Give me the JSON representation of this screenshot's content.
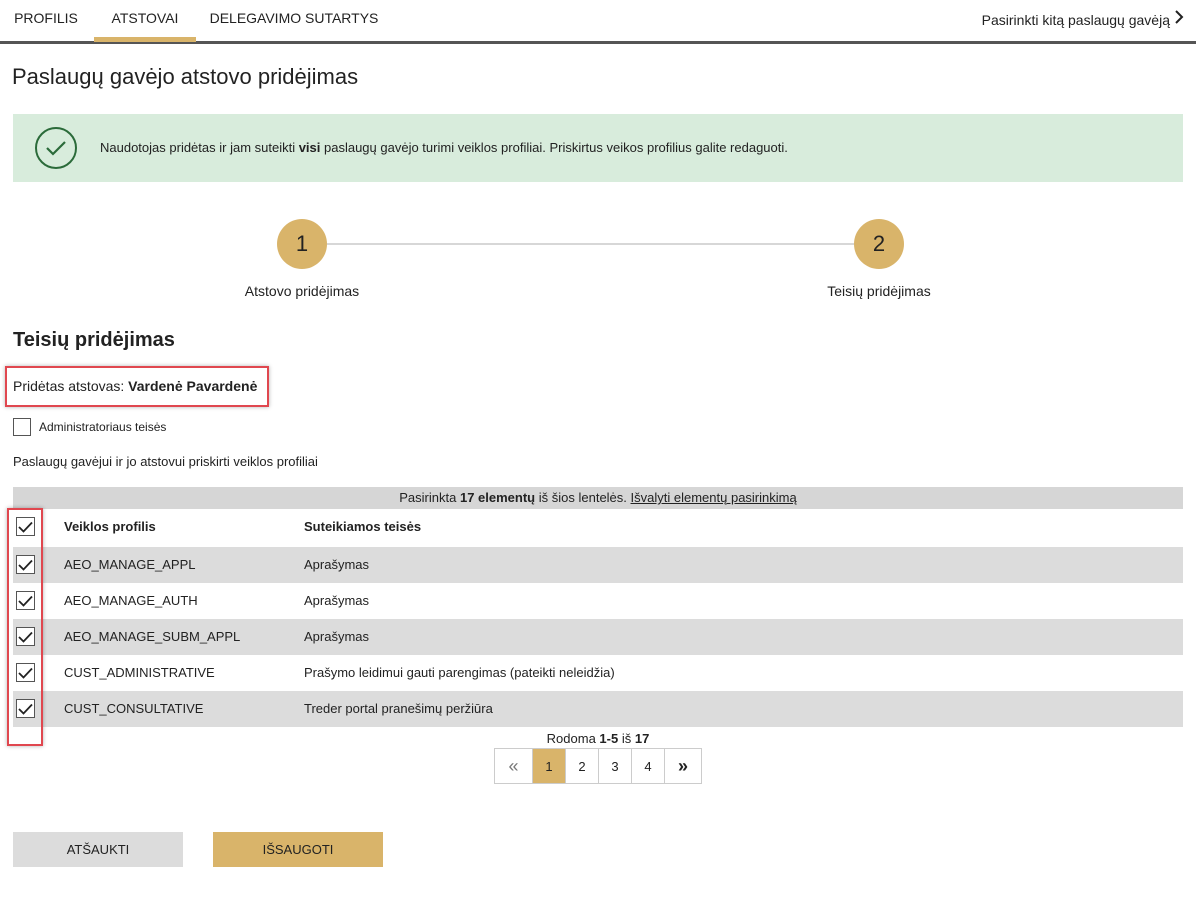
{
  "nav": {
    "tabs": [
      {
        "label": "PROFILIS",
        "active": false
      },
      {
        "label": "ATSTOVAI",
        "active": true
      },
      {
        "label": "DELEGAVIMO SUTARTYS",
        "active": false
      }
    ],
    "choose_link": "Pasirinkti kitą paslaugų gavėją"
  },
  "page_title": "Paslaugų gavėjo atstovo pridėjimas",
  "alert": {
    "text_before": "Naudotojas pridėtas ir jam suteikti ",
    "text_bold": "visi",
    "text_after": " paslaugų gavėjo turimi veiklos profiliai. Priskirtus veikos profilius galite redaguoti.",
    "icon": "check-circle-icon"
  },
  "stepper": {
    "steps": [
      {
        "number": "1",
        "label": "Atstovo pridėjimas"
      },
      {
        "number": "2",
        "label": "Teisių pridėjimas"
      }
    ]
  },
  "section_title": "Teisių pridėjimas",
  "added": {
    "label": "Pridėtas atstovas:",
    "name": "Vardenė Pavardenė"
  },
  "admin_checkbox": {
    "label": "Administratoriaus teisės",
    "checked": false
  },
  "assigned_label": "Paslaugų gavėjui ir jo atstovui priskirti veiklos profiliai",
  "selection_bar": {
    "prefix": "Pasirinkta",
    "count": "17 elementų",
    "suffix": "iš šios lentelės.",
    "clear_link": "Išvalyti elementų pasirinkimą"
  },
  "table": {
    "headers": [
      "Veiklos profilis",
      "Suteikiamos teisės"
    ],
    "rows": [
      {
        "profile": "AEO_MANAGE_APPL",
        "rights": "Aprašymas",
        "checked": true
      },
      {
        "profile": "AEO_MANAGE_AUTH",
        "rights": "Aprašymas",
        "checked": true
      },
      {
        "profile": "AEO_MANAGE_SUBM_APPL",
        "rights": "Aprašymas",
        "checked": true
      },
      {
        "profile": "CUST_ADMINISTRATIVE",
        "rights": "Prašymo leidimui gauti parengimas (pateikti neleidžia)",
        "checked": true
      },
      {
        "profile": "CUST_CONSULTATIVE",
        "rights": "Treder portal pranešimų peržiūra",
        "checked": true
      }
    ]
  },
  "pagination": {
    "showing_prefix": "Rodoma",
    "range": "1-5",
    "of": "iš",
    "total": "17",
    "pages": [
      "1",
      "2",
      "3",
      "4"
    ],
    "current": "1",
    "first_icon": "«",
    "last_icon": "»"
  },
  "buttons": {
    "cancel": "ATŠAUKTI",
    "save": "IŠSAUGOTI"
  },
  "colors": {
    "accent": "#d9b46a",
    "success_bg": "#d8ecdc",
    "highlight": "#e0474f"
  }
}
